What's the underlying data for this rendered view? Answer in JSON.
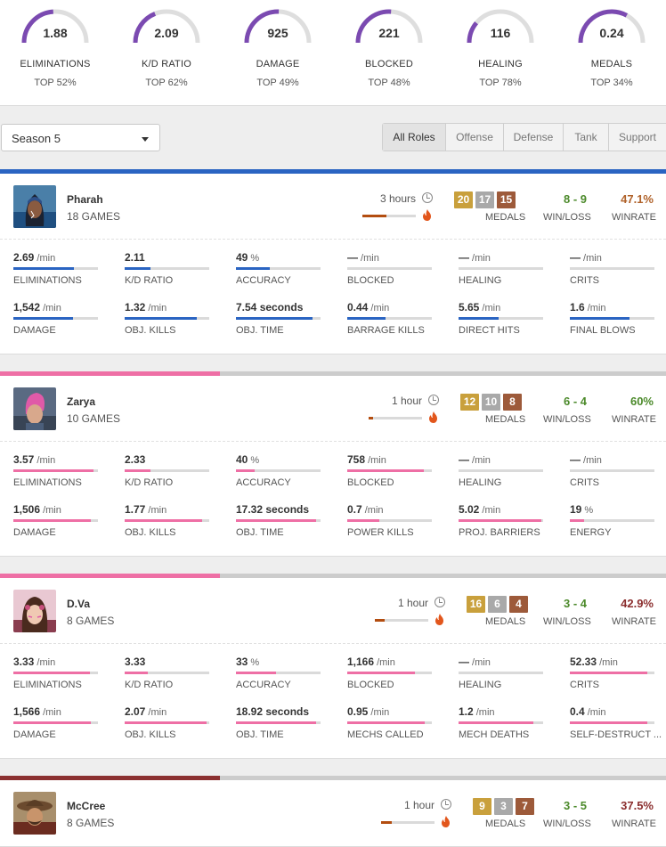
{
  "summary": [
    {
      "value": "1.88",
      "label": "ELIMINATIONS",
      "rank": "TOP 52%",
      "fill": 0.48
    },
    {
      "value": "2.09",
      "label": "K/D RATIO",
      "rank": "TOP 62%",
      "fill": 0.38
    },
    {
      "value": "925",
      "label": "DAMAGE",
      "rank": "TOP 49%",
      "fill": 0.51
    },
    {
      "value": "221",
      "label": "BLOCKED",
      "rank": "TOP 48%",
      "fill": 0.52
    },
    {
      "value": "116",
      "label": "HEALING",
      "rank": "TOP 78%",
      "fill": 0.22
    },
    {
      "value": "0.24",
      "label": "MEDALS",
      "rank": "TOP 34%",
      "fill": 0.66
    }
  ],
  "season_select": {
    "value": "Season 5"
  },
  "role_tabs": [
    "All Roles",
    "Offense",
    "Defense",
    "Tank",
    "Support"
  ],
  "active_role": "All Roles",
  "labels": {
    "medals": "MEDALS",
    "winloss": "WIN/LOSS",
    "winrate": "WINRATE"
  },
  "colors": {
    "pharah": "#2a64c2",
    "zarya": "#ee6fa5",
    "dva": "#ee6fa5",
    "mccree": "#8b3030",
    "gauge": "#7b4ab1",
    "win": "#4c8a2b",
    "rate_orange": "#b0622a",
    "rate_red": "#8b2e2e"
  },
  "heroes": [
    {
      "name": "Pharah",
      "games": "18 GAMES",
      "time": "3 hours",
      "time_fill": 0.45,
      "medals": {
        "gold": "20",
        "silver": "17",
        "bronze": "15"
      },
      "wl": "8 - 9",
      "winrate": "47.1%",
      "winrate_color": "#b0622a",
      "color": "#2a64c2",
      "bar_fill": 1.0,
      "stats": [
        {
          "value": "2.69",
          "unit": "/min",
          "label": "ELIMINATIONS",
          "fill": 0.72
        },
        {
          "value": "2.11",
          "unit": "",
          "label": "K/D RATIO",
          "fill": 0.3
        },
        {
          "value": "49",
          "unit": "%",
          "label": "ACCURACY",
          "fill": 0.4
        },
        {
          "value": "—",
          "unit": "/min",
          "label": "BLOCKED",
          "fill": 0
        },
        {
          "value": "—",
          "unit": "/min",
          "label": "HEALING",
          "fill": 0
        },
        {
          "value": "—",
          "unit": "/min",
          "label": "CRITS",
          "fill": 0
        },
        {
          "value": "1,542",
          "unit": "/min",
          "label": "DAMAGE",
          "fill": 0.7
        },
        {
          "value": "1.32",
          "unit": "/min",
          "label": "OBJ. KILLS",
          "fill": 0.85
        },
        {
          "value": "7.54 seconds",
          "unit": "",
          "label": "OBJ. TIME",
          "fill": 0.9
        },
        {
          "value": "0.44",
          "unit": "/min",
          "label": "BARRAGE KILLS",
          "fill": 0.45
        },
        {
          "value": "5.65",
          "unit": "/min",
          "label": "DIRECT HITS",
          "fill": 0.47
        },
        {
          "value": "1.6",
          "unit": "/min",
          "label": "FINAL BLOWS",
          "fill": 0.7
        }
      ]
    },
    {
      "name": "Zarya",
      "games": "10 GAMES",
      "time": "1 hour",
      "time_fill": 0.08,
      "medals": {
        "gold": "12",
        "silver": "10",
        "bronze": "8"
      },
      "wl": "6 - 4",
      "winrate": "60%",
      "winrate_color": "#4c8a2b",
      "color": "#ee6fa5",
      "bar_fill": 0.33,
      "stats": [
        {
          "value": "3.57",
          "unit": "/min",
          "label": "ELIMINATIONS",
          "fill": 0.95
        },
        {
          "value": "2.33",
          "unit": "",
          "label": "K/D RATIO",
          "fill": 0.3
        },
        {
          "value": "40",
          "unit": "%",
          "label": "ACCURACY",
          "fill": 0.22
        },
        {
          "value": "758",
          "unit": "/min",
          "label": "BLOCKED",
          "fill": 0.9
        },
        {
          "value": "—",
          "unit": "/min",
          "label": "HEALING",
          "fill": 0
        },
        {
          "value": "—",
          "unit": "/min",
          "label": "CRITS",
          "fill": 0
        },
        {
          "value": "1,506",
          "unit": "/min",
          "label": "DAMAGE",
          "fill": 0.92
        },
        {
          "value": "1.77",
          "unit": "/min",
          "label": "OBJ. KILLS",
          "fill": 0.92
        },
        {
          "value": "17.32 seconds",
          "unit": "",
          "label": "OBJ. TIME",
          "fill": 0.95
        },
        {
          "value": "0.7",
          "unit": "/min",
          "label": "POWER KILLS",
          "fill": 0.38
        },
        {
          "value": "5.02",
          "unit": "/min",
          "label": "PROJ. BARRIERS",
          "fill": 0.98
        },
        {
          "value": "19",
          "unit": "%",
          "label": "ENERGY",
          "fill": 0.17
        }
      ]
    },
    {
      "name": "D.Va",
      "games": "8 GAMES",
      "time": "1 hour",
      "time_fill": 0.18,
      "medals": {
        "gold": "16",
        "silver": "6",
        "bronze": "4"
      },
      "wl": "3 - 4",
      "winrate": "42.9%",
      "winrate_color": "#8b2e2e",
      "color": "#ee6fa5",
      "bar_fill": 0.33,
      "stats": [
        {
          "value": "3.33",
          "unit": "/min",
          "label": "ELIMINATIONS",
          "fill": 0.9
        },
        {
          "value": "3.33",
          "unit": "",
          "label": "K/D RATIO",
          "fill": 0.27
        },
        {
          "value": "33",
          "unit": "%",
          "label": "ACCURACY",
          "fill": 0.47
        },
        {
          "value": "1,166",
          "unit": "/min",
          "label": "BLOCKED",
          "fill": 0.8
        },
        {
          "value": "—",
          "unit": "/min",
          "label": "HEALING",
          "fill": 0
        },
        {
          "value": "52.33",
          "unit": "/min",
          "label": "CRITS",
          "fill": 0.92
        },
        {
          "value": "1,566",
          "unit": "/min",
          "label": "DAMAGE",
          "fill": 0.92
        },
        {
          "value": "2.07",
          "unit": "/min",
          "label": "OBJ. KILLS",
          "fill": 0.97
        },
        {
          "value": "18.92 seconds",
          "unit": "",
          "label": "OBJ. TIME",
          "fill": 0.95
        },
        {
          "value": "0.95",
          "unit": "/min",
          "label": "MECHS CALLED",
          "fill": 0.92
        },
        {
          "value": "1.2",
          "unit": "/min",
          "label": "MECH DEATHS",
          "fill": 0.88
        },
        {
          "value": "0.4",
          "unit": "/min",
          "label": "SELF-DESTRUCT ...",
          "fill": 0.92
        }
      ]
    },
    {
      "name": "McCree",
      "games": "8 GAMES",
      "time": "1 hour",
      "time_fill": 0.2,
      "medals": {
        "gold": "9",
        "silver": "3",
        "bronze": "7"
      },
      "wl": "3 - 5",
      "winrate": "37.5%",
      "winrate_color": "#8b2e2e",
      "color": "#8b3030",
      "bar_fill": 0.33,
      "stats": []
    }
  ]
}
